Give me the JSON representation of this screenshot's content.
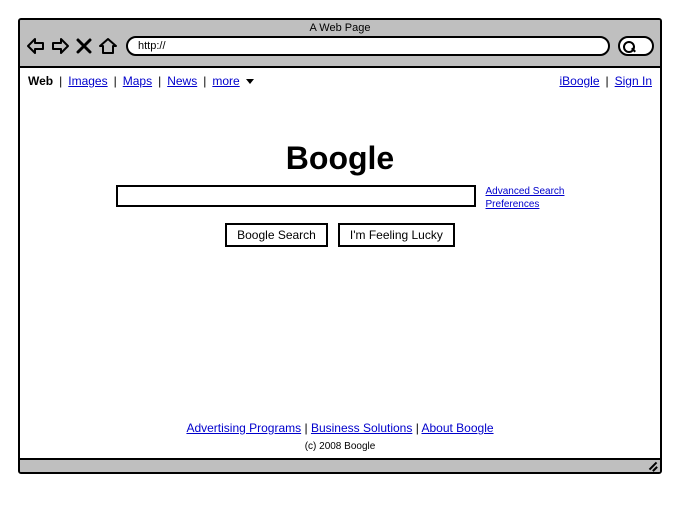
{
  "window": {
    "title": "A Web Page"
  },
  "url": {
    "value": "http://"
  },
  "nav": {
    "web": "Web",
    "images": "Images",
    "maps": "Maps",
    "news": "News",
    "more": "more",
    "iboogle": "iBoogle",
    "signin": "Sign In"
  },
  "main": {
    "logo": "Boogle",
    "search_button": "Boogle Search",
    "lucky_button": "I'm Feeling Lucky",
    "advanced": "Advanced Search",
    "preferences": "Preferences"
  },
  "footer": {
    "advertising": "Advertising Programs",
    "business": "Business Solutions",
    "about": "About Boogle",
    "copyright": "(c) 2008 Boogle"
  }
}
